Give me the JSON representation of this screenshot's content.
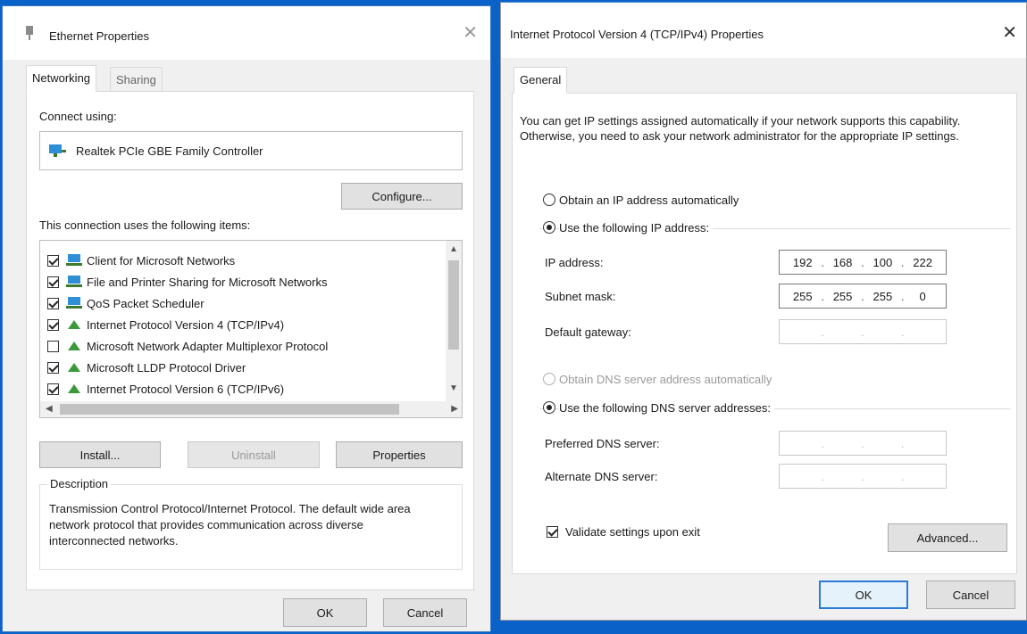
{
  "left_dialog": {
    "title": "Ethernet Properties",
    "close_glyph": "✕",
    "tabs": [
      {
        "label": "Networking",
        "active": true
      },
      {
        "label": "Sharing",
        "active": false
      }
    ],
    "connect_using_label": "Connect using:",
    "adapter_name": "Realtek PCIe GBE Family Controller",
    "configure_label": "Configure...",
    "items_label": "This connection uses the following items:",
    "items": [
      {
        "label": "Client for Microsoft Networks",
        "checked": true,
        "icon": "network-client-icon"
      },
      {
        "label": "File and Printer Sharing for Microsoft Networks",
        "checked": true,
        "icon": "network-client-icon"
      },
      {
        "label": "QoS Packet Scheduler",
        "checked": true,
        "icon": "network-client-icon"
      },
      {
        "label": "Internet Protocol Version 4 (TCP/IPv4)",
        "checked": true,
        "icon": "protocol-icon"
      },
      {
        "label": "Microsoft Network Adapter Multiplexor Protocol",
        "checked": false,
        "icon": "protocol-icon"
      },
      {
        "label": "Microsoft LLDP Protocol Driver",
        "checked": true,
        "icon": "protocol-icon"
      },
      {
        "label": "Internet Protocol Version 6 (TCP/IPv6)",
        "checked": true,
        "icon": "protocol-icon"
      }
    ],
    "install_label": "Install...",
    "uninstall_label": "Uninstall",
    "properties_label": "Properties",
    "description_label": "Description",
    "description_text": "Transmission Control Protocol/Internet Protocol. The default wide area network protocol that provides communication across diverse interconnected networks.",
    "ok_label": "OK",
    "cancel_label": "Cancel"
  },
  "right_dialog": {
    "title": "Internet Protocol Version 4 (TCP/IPv4) Properties",
    "close_glyph": "✕",
    "tab_label": "General",
    "intro_text": "You can get IP settings assigned automatically if your network supports this capability. Otherwise, you need to ask your network administrator for the appropriate IP settings.",
    "obtain_ip_auto_label": "Obtain an IP address automatically",
    "use_ip_label": "Use the following IP address:",
    "ip_address_label": "IP address:",
    "ip_address": [
      "192",
      "168",
      "100",
      "222"
    ],
    "subnet_mask_label": "Subnet mask:",
    "subnet_mask": [
      "255",
      "255",
      "255",
      "0"
    ],
    "default_gateway_label": "Default gateway:",
    "default_gateway": [
      "",
      "",
      "",
      ""
    ],
    "obtain_dns_auto_label": "Obtain DNS server address automatically",
    "use_dns_label": "Use the following DNS server addresses:",
    "preferred_dns_label": "Preferred DNS server:",
    "preferred_dns": [
      "",
      "",
      "",
      ""
    ],
    "alternate_dns_label": "Alternate DNS server:",
    "alternate_dns": [
      "",
      "",
      "",
      ""
    ],
    "validate_label": "Validate settings upon exit",
    "validate_checked": true,
    "advanced_label": "Advanced...",
    "ok_label": "OK",
    "cancel_label": "Cancel"
  },
  "colors": {
    "desktop": "#0a62c9",
    "dialog_bg": "#f0f0f0",
    "accent_border": "#2b7bd8",
    "selection_blue": "#3b8fe0"
  }
}
